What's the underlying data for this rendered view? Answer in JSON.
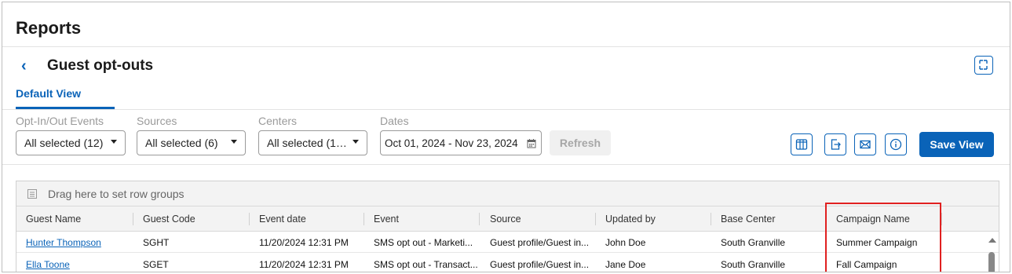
{
  "page": {
    "title": "Reports",
    "subtitle": "Guest opt-outs"
  },
  "tabs": [
    {
      "label": "Default View",
      "active": true
    }
  ],
  "filters": {
    "events": {
      "label": "Opt-In/Out Events",
      "value": "All selected (12)"
    },
    "sources": {
      "label": "Sources",
      "value": "All selected (6)"
    },
    "centers": {
      "label": "Centers",
      "value": "All selected (1…"
    },
    "dates": {
      "label": "Dates",
      "value": "Oct 01, 2024 - Nov 23, 2024"
    }
  },
  "toolbar": {
    "refresh_label": "Refresh",
    "save_label": "Save View"
  },
  "grid": {
    "group_placeholder": "Drag here to set row groups",
    "columns": [
      "Guest Name",
      "Guest Code",
      "Event date",
      "Event",
      "Source",
      "Updated by",
      "Base Center",
      "Campaign Name"
    ],
    "rows": [
      [
        "Hunter Thompson",
        "SGHT",
        "11/20/2024 12:31 PM",
        "SMS opt out - Marketi...",
        "Guest profile/Guest in...",
        "John Doe",
        "South Granville",
        "Summer Campaign"
      ],
      [
        "Ella Toone",
        "SGET",
        "11/20/2024 12:31 PM",
        "SMS opt out - Transact...",
        "Guest profile/Guest in...",
        "Jane Doe",
        "South Granville",
        "Fall Campaign"
      ]
    ]
  },
  "colors": {
    "accent": "#0a63b8",
    "highlight": "#e02020"
  }
}
